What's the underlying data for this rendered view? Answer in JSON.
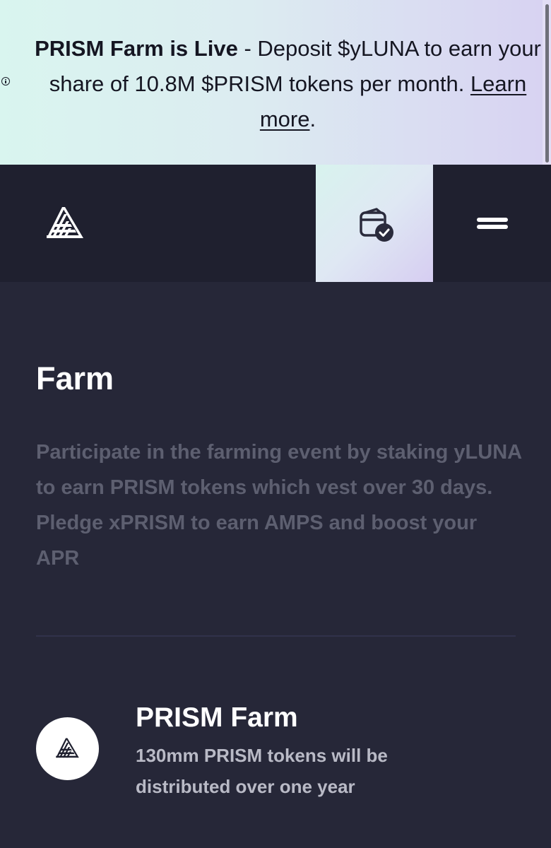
{
  "banner": {
    "headline": "PRISM Farm is Live",
    "separator": " - ",
    "message": "Deposit $yLUNA to earn your share of 10.8M $PRISM tokens per month.",
    "link_label": "Learn more",
    "trailing": ".",
    "icon": "info-icon"
  },
  "navbar": {
    "logo_icon": "prism-logo-icon",
    "wallet_icon": "wallet-connected-icon",
    "menu_icon": "menu-icon"
  },
  "page": {
    "title": "Farm",
    "description": "Participate in the farming event by staking yLUNA to earn PRISM tokens which vest over 30 days. Pledge xPRISM to earn AMPS and boost your APR"
  },
  "farm_card": {
    "icon": "prism-logo-icon",
    "title": "PRISM Farm",
    "description": "130mm PRISM tokens will be distributed over one year"
  },
  "colors": {
    "background": "#262738",
    "navbar": "#1f202f",
    "text_primary": "#ffffff",
    "text_muted": "#5d5f70"
  }
}
